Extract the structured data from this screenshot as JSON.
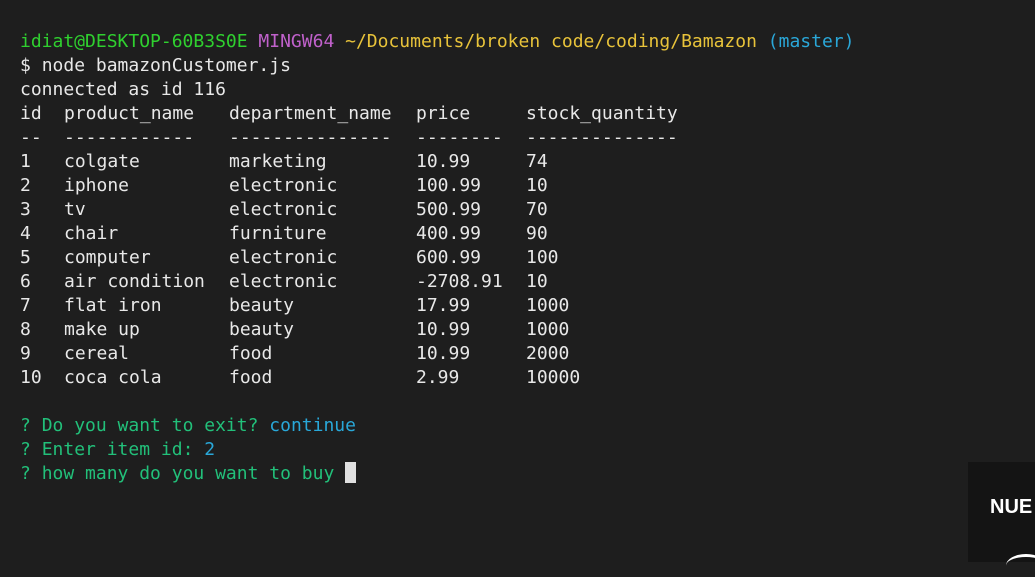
{
  "prompt": {
    "user_host": "idiat@DESKTOP-60B3S0E",
    "env": "MINGW64",
    "path": "~/Documents/broken code/coding/Bamazon",
    "branch": "(master)"
  },
  "command": {
    "symbol": "$",
    "text": "node bamazonCustomer.js"
  },
  "connected_message": "connected as id 116",
  "table": {
    "headers": [
      "id",
      "product_name",
      "department_name",
      "price",
      "stock_quantity"
    ],
    "separators": [
      "--",
      "------------",
      "---------------",
      "--------",
      "--------------"
    ],
    "rows": [
      [
        "1",
        "colgate",
        "marketing",
        "10.99",
        "74"
      ],
      [
        "2",
        "iphone",
        "electronic",
        "100.99",
        "10"
      ],
      [
        "3",
        "tv",
        "electronic",
        "500.99",
        "70"
      ],
      [
        "4",
        "chair",
        "furniture",
        "400.99",
        "90"
      ],
      [
        "5",
        "computer",
        "electronic",
        "600.99",
        "100"
      ],
      [
        "6",
        "air condition",
        "electronic",
        "-2708.91",
        "10"
      ],
      [
        "7",
        "flat iron",
        "beauty",
        "17.99",
        "1000"
      ],
      [
        "8",
        "make up",
        "beauty",
        "10.99",
        "1000"
      ],
      [
        "9",
        "cereal",
        "food",
        "10.99",
        "2000"
      ],
      [
        "10",
        "coca cola",
        "food",
        "2.99",
        "10000"
      ]
    ]
  },
  "questions": [
    {
      "marker": "?",
      "text": "Do you want to exit?",
      "answer": "continue"
    },
    {
      "marker": "?",
      "text": "Enter item id:",
      "answer": "2"
    },
    {
      "marker": "?",
      "text": "how many do you want to buy",
      "answer": ""
    }
  ],
  "corner_widget": {
    "text": "NUE"
  },
  "colors": {
    "background": "#1e1e1e",
    "user_host": "#2fd02f",
    "env": "#c061cb",
    "path": "#e8c33a",
    "branch": "#2aa7d8",
    "question": "#22c07a",
    "answer": "#29a8d9",
    "text": "#e8e8e8"
  }
}
